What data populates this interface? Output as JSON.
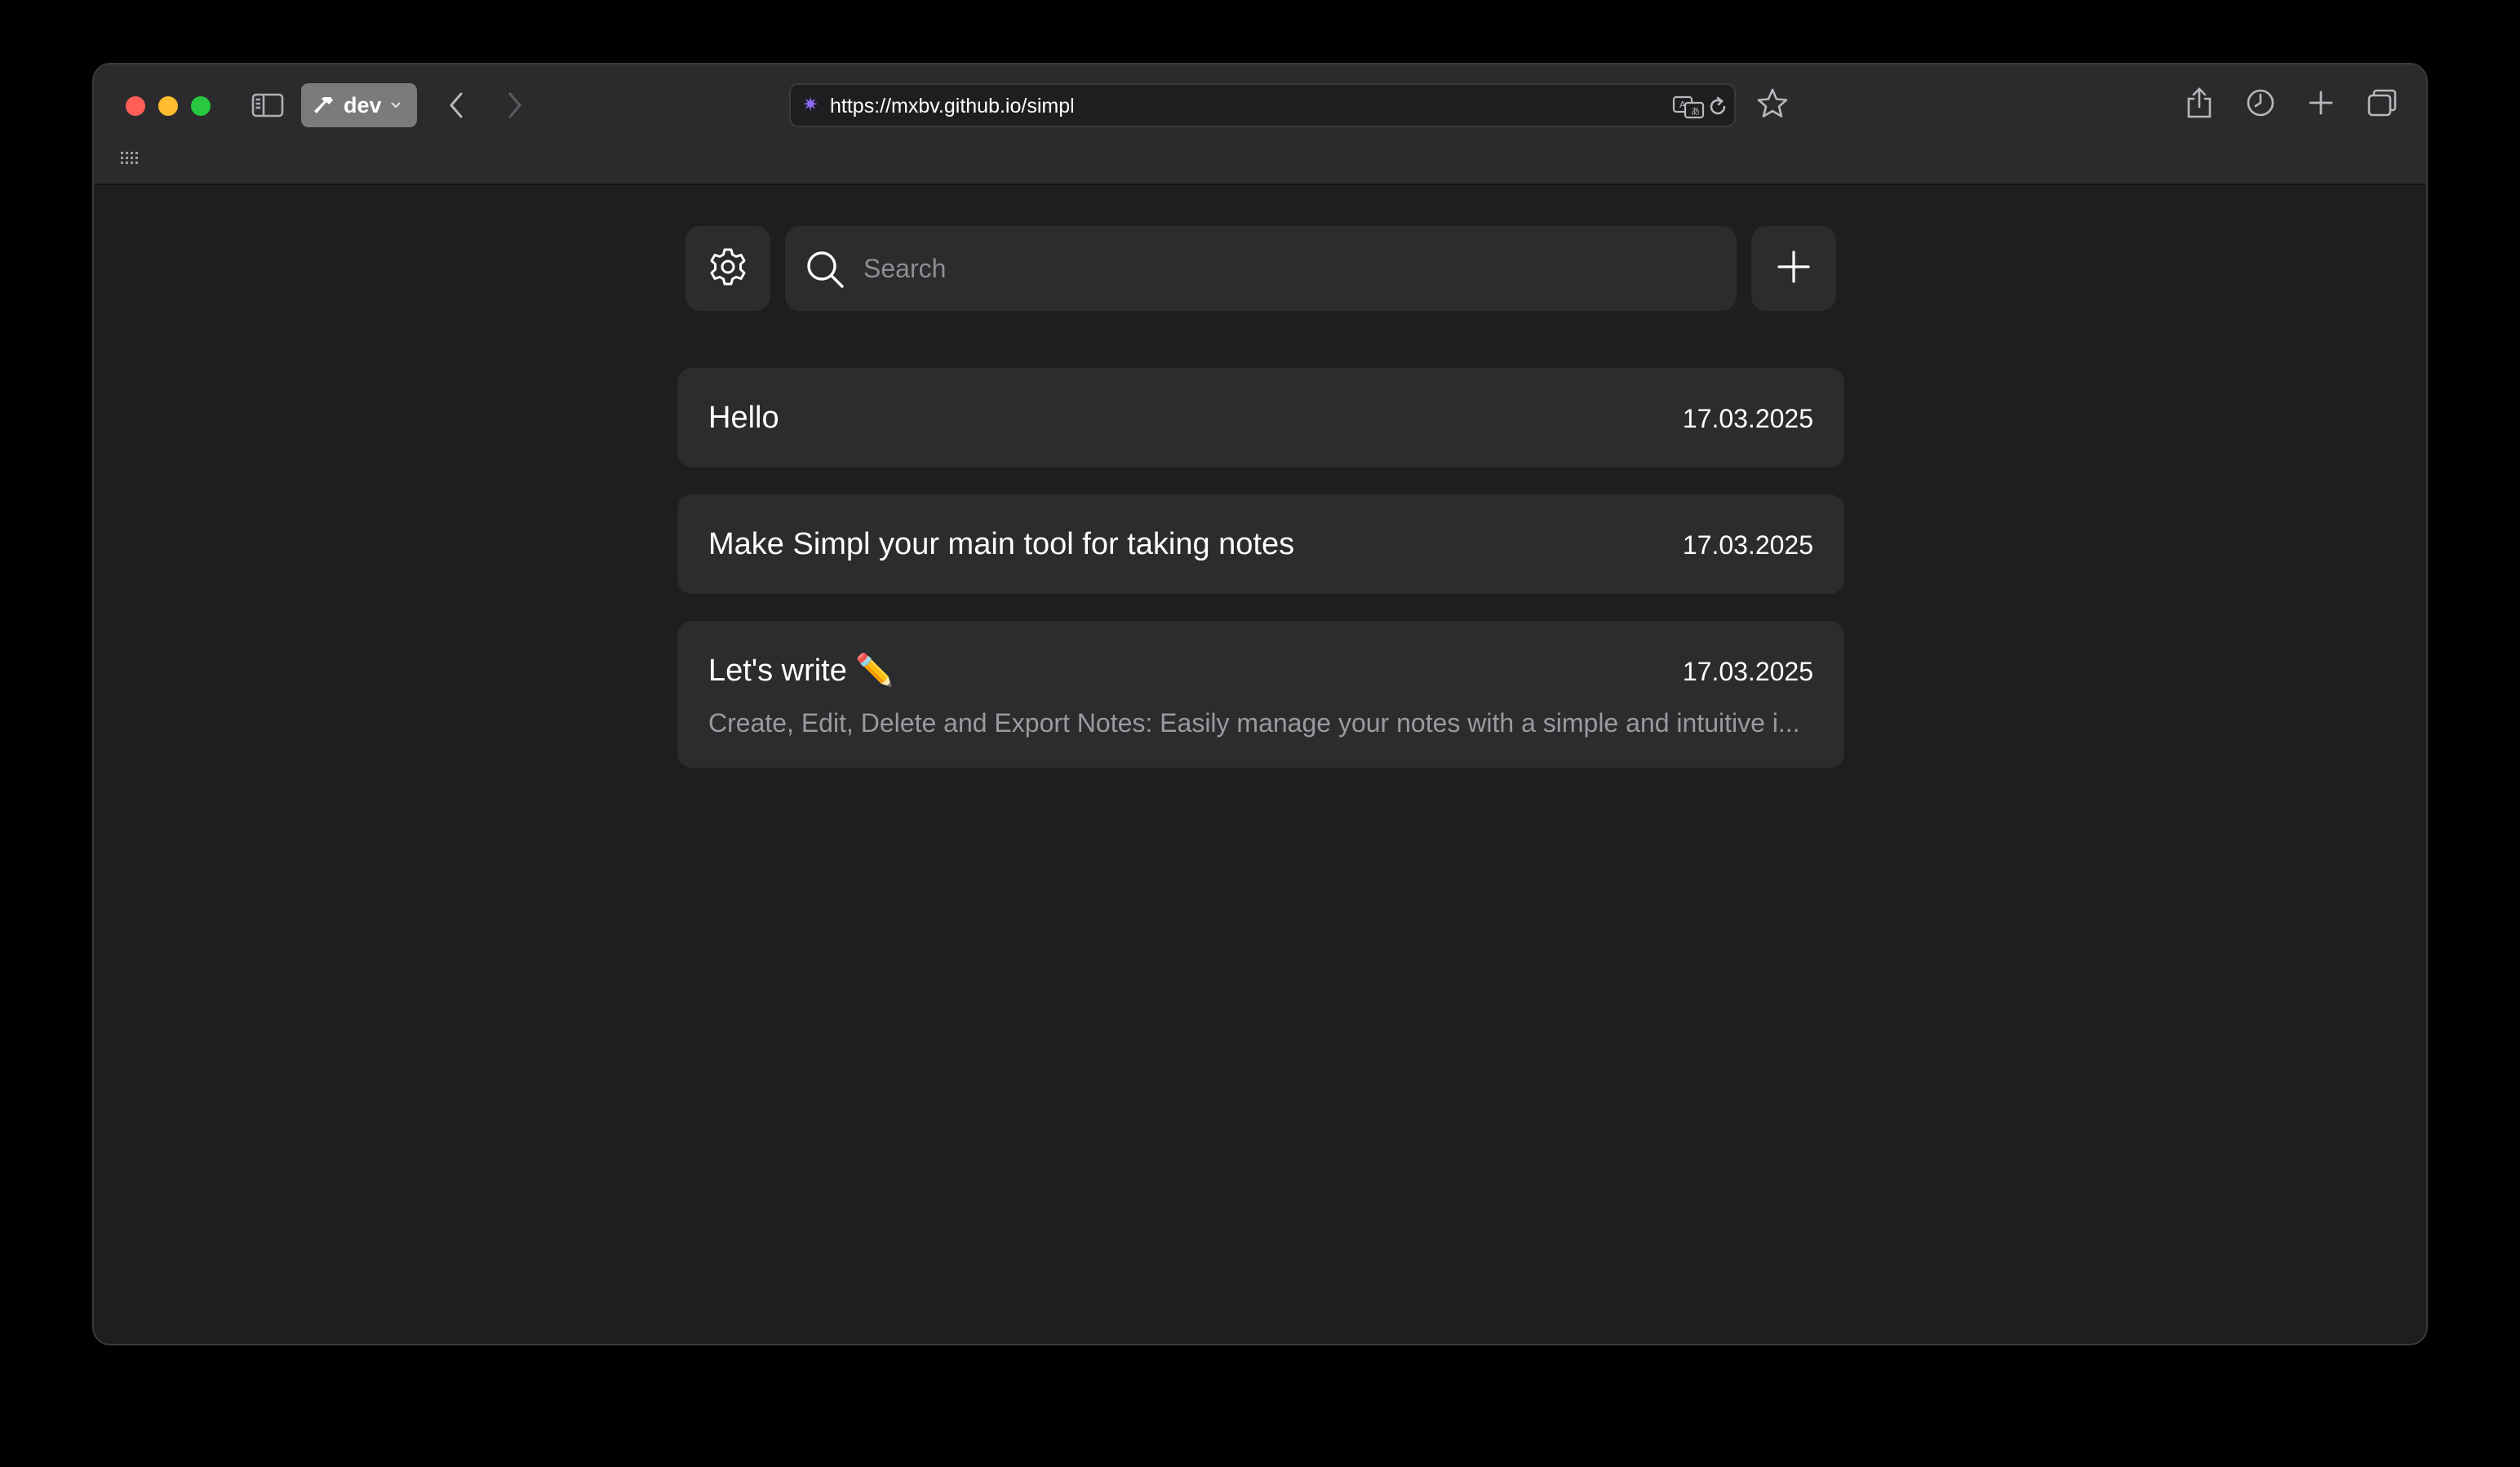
{
  "browser": {
    "profile_label": "dev",
    "url": "https://mxbv.github.io/simpl",
    "favicon_glyph": "✷",
    "icons": {
      "sidebar": "sidebar-toggle-icon",
      "back": "chevron-left-icon",
      "forward": "chevron-right-icon",
      "translate": "translate-icon",
      "reload": "reload-icon",
      "bookmark": "star-icon",
      "share": "share-icon",
      "history": "clock-icon",
      "new_tab": "plus-icon",
      "tabs_overview": "tabs-overview-icon",
      "favorites_bar": "grid-icon"
    }
  },
  "app": {
    "search_placeholder": "Search",
    "notes": [
      {
        "title": "Hello",
        "date": "17.03.2025"
      },
      {
        "title": "Make Simpl your main tool for taking notes",
        "date": "17.03.2025"
      },
      {
        "title": "Let's write ✏️",
        "date": "17.03.2025",
        "preview": "Create, Edit, Delete and Export Notes: Easily manage your notes with a simple and intuitive i..."
      }
    ]
  },
  "colors": {
    "page_background": "#000000",
    "window_background": "#1e1e20",
    "toolbar_background": "#2b2b2d",
    "card_background": "#2c2c2e",
    "text_primary": "#ffffff",
    "text_secondary": "#9a9a9f",
    "close": "#ff5f57",
    "minimize": "#febc2e",
    "maximize": "#28c840",
    "favicon": "#8e6bff"
  }
}
